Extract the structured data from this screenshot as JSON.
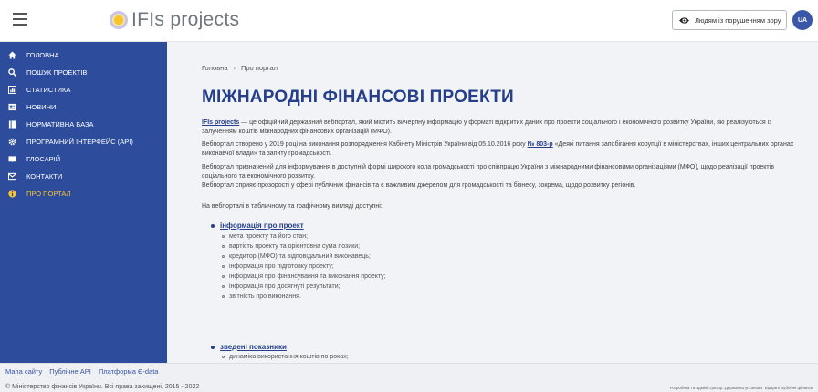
{
  "header": {
    "logo_text": "IFIs projects",
    "a11y_label": "Людям із порушенням зору",
    "lang": "UA"
  },
  "sidebar": {
    "items": [
      {
        "label": "ГОЛОВНА",
        "icon": "home-icon"
      },
      {
        "label": "ПОШУК ПРОЕКТІВ",
        "icon": "search-icon"
      },
      {
        "label": "СТАТИСТИКА",
        "icon": "chart-icon"
      },
      {
        "label": "НОВИНИ",
        "icon": "news-icon"
      },
      {
        "label": "НОРМАТИВНА БАЗА",
        "icon": "book-icon"
      },
      {
        "label": "ПРОГРАМНИЙ ІНТЕРФЕЙС (API)",
        "icon": "gear-icon"
      },
      {
        "label": "ГЛОСАРІЙ",
        "icon": "glossary-icon"
      },
      {
        "label": "КОНТАКТИ",
        "icon": "mail-icon"
      },
      {
        "label": "ПРО ПОРТАЛ",
        "icon": "info-icon",
        "active": true
      }
    ],
    "active_color": "#f7c436",
    "bg_color": "#2d4c9c"
  },
  "main": {
    "breadcrumb": {
      "home": "Головна",
      "sep": "›",
      "current": "Про портал"
    },
    "title": "МІЖНАРОДНІ ФІНАНСОВІ ПРОЕКТИ",
    "p1_link": "IFIs projects",
    "p1_text": " — це офіційний державний вебпортал, який містить вичерпну інформацію у форматі відкритих даних про проекти соціального і економічного розвитку України, які реалізуються із залученням коштів міжнародних фінансових організацій (МФО).",
    "p2_pre": "Вебпортал створено у 2019 році на виконання розпорядження Кабінету Міністрів України від 05.10.2016 року ",
    "p2_link": "№ 803-р",
    "p2_post": " «Деякі питання запобігання корупції в міністерствах, інших центральних органах виконавчої влади» та запиту громадськості.",
    "p3a": "Вебпортал призначений для інформування в доступній формі широкого кола громадськості про співпрацю України з міжнародними фінансовими організаціями (МФО), щодо реалізації проектів соціального та економічного розвитку.",
    "p3b": "Вебпортал сприяє прозорості у сфері публічних фінансів та є важливим джерелом для громадськості та бізнесу, зокрема, щодо розвитку регіонів.",
    "p4": "На вебпорталі в табличному та графічному вигляді доступні:",
    "list1_head": "інформація про проект",
    "list1": [
      "мета проекту та його стан;",
      "вартість проекту та орієнтовна сума позики;",
      "кредитор (МФО) та відповідальний виконавець;",
      "інформація про підготовку проекту;",
      "інформація про фінансування та виконання проекту;",
      "інформація про досягнуті результати;",
      "звітність про виконання."
    ],
    "list2_head": "зведені показники",
    "list2": [
      "динаміка використання коштів по роках;"
    ]
  },
  "footer": {
    "links": [
      "Мапа сайту",
      "Публічне API",
      "Платформа Є-data"
    ],
    "copyright": "© Міністерство фінансів України. Всі права захищені, 2015 - 2022",
    "developer": "Розробник та адміністратор: Державна установа \"Відкриті публічні фінанси\""
  }
}
